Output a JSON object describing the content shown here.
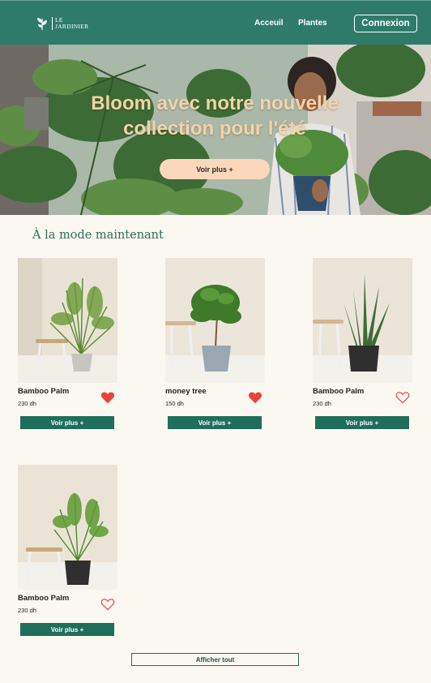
{
  "header": {
    "logo_line1": "LE",
    "logo_line2": "JARDINIER",
    "nav": [
      "Acceuil",
      "Plantes"
    ],
    "login_label": "Connexion"
  },
  "hero": {
    "title_line1": "Bloom avec notre nouvelle",
    "title_line2": "collection pour l'été",
    "cta_label": "Voir plus +"
  },
  "section": {
    "title": "À la mode maintenant"
  },
  "products": [
    {
      "name": "Bamboo Palm",
      "price": "230 dh",
      "favorite": true,
      "button": "Voir plus +"
    },
    {
      "name": "money tree",
      "price": "150 dh",
      "favorite": true,
      "button": "Voir plus +"
    },
    {
      "name": "Bamboo Palm",
      "price": "230 dh",
      "favorite": false,
      "button": "Voir plus +"
    },
    {
      "name": "Bamboo Palm",
      "price": "230 dh",
      "favorite": false,
      "button": "Voir plus +"
    }
  ],
  "show_all_label": "Afficher tout",
  "colors": {
    "brand": "#2f7b6a",
    "button": "#1f6e5c",
    "heart": "#e8433a",
    "hero_title": "#f6d2a7",
    "hero_cta": "#fbd8bb",
    "background": "#fbf8f1"
  },
  "icons": [
    "leaf-logo-icon",
    "heart-filled-icon",
    "heart-outline-icon"
  ]
}
